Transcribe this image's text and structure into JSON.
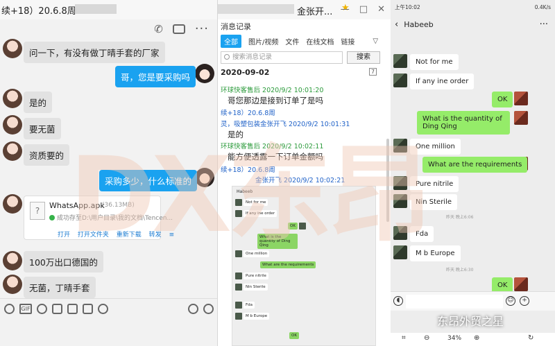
{
  "left_window": {
    "title": "续+18）20.6.8周",
    "messages": [
      {
        "side": "left",
        "text": "问一下，有没有做丁晴手套的厂家"
      },
      {
        "side": "right",
        "text": "哥，您是要采购吗"
      },
      {
        "side": "left",
        "text": "是的"
      },
      {
        "side": "left",
        "text": "要无菌"
      },
      {
        "side": "left",
        "text": "资质要的"
      },
      {
        "side": "right",
        "text": "采购多少，什么标准的"
      },
      {
        "side": "left",
        "text": "100万出口德国的"
      },
      {
        "side": "left",
        "text": "无菌，丁晴手套"
      }
    ],
    "file": {
      "name": "WhatsApp.apk",
      "size": "(36.13MB)",
      "status": "成功存至D:\\用户目录\\我的文档\\Tencen...",
      "actions": [
        "打开",
        "打开文件夹",
        "重新下载",
        "转发"
      ]
    },
    "bottom_icon_gif": "GIF"
  },
  "record_window": {
    "title": "金张开...",
    "panel_title": "消息记录",
    "tabs": [
      "全部",
      "图片/视频",
      "文件",
      "在线文档",
      "链接"
    ],
    "search_placeholder": "搜索消息记录",
    "search_button": "搜索",
    "date": "2020-09-02",
    "entries": [
      {
        "meta": "环球快客售后 2020/9/2 10:01:20",
        "color": "green",
        "text": "哥您那边是接到订单了是吗"
      },
      {
        "meta": "续+18）20.6.8周",
        "color": "blue",
        "text": ""
      },
      {
        "meta": "灵，吸塑包装金张开飞 2020/9/2 10:01:31",
        "color": "blue",
        "text": "是的"
      },
      {
        "meta": "环球快客售后 2020/9/2 10:02:11",
        "color": "green",
        "text": "能方便透露一下订单金额吗"
      },
      {
        "meta": "续+18）20.6.8周",
        "color": "blue",
        "text": ""
      },
      {
        "meta": "金张开飞 2020/9/2 10:02:21",
        "color": "blue",
        "text": ""
      }
    ],
    "preview": {
      "contact": "Habeeb",
      "messages": [
        "Not for me",
        "If any ine order",
        "OK",
        "What is the quantity of Ding Qing",
        "One million",
        "What are the requirements",
        "Pure nitrile",
        "Nin Sterile",
        "Fda",
        "M b Europe",
        "OK"
      ]
    }
  },
  "phone": {
    "status_time": "上午10:02",
    "status_right": "0.4K/s",
    "contact": "Habeeb",
    "messages": [
      {
        "side": "left",
        "text": "Not for me"
      },
      {
        "side": "left",
        "text": "If any ine order"
      },
      {
        "side": "right",
        "text": "OK"
      },
      {
        "side": "right",
        "text": "What is the quantity of Ding Qing"
      },
      {
        "side": "left",
        "text": "One million"
      },
      {
        "side": "right",
        "text": "What are the requirements"
      },
      {
        "side": "left",
        "text": "Pure nitrile"
      },
      {
        "side": "left",
        "text": "Nin Sterile"
      },
      {
        "side": "left",
        "text": "Fda"
      },
      {
        "side": "left",
        "text": "M b Europe"
      },
      {
        "side": "right",
        "text": "OK"
      }
    ],
    "system_times": [
      "昨天 晚上6:06",
      "昨天 晚上6:30"
    ],
    "zoom": "34%"
  },
  "watermark": "DX东昂",
  "brand": "东昂外贸之星",
  "colors": {
    "qq_blue": "#1aa2f0",
    "wechat_green": "#95ec69",
    "record_green": "#2a9a3a",
    "record_blue": "#2062c8"
  }
}
